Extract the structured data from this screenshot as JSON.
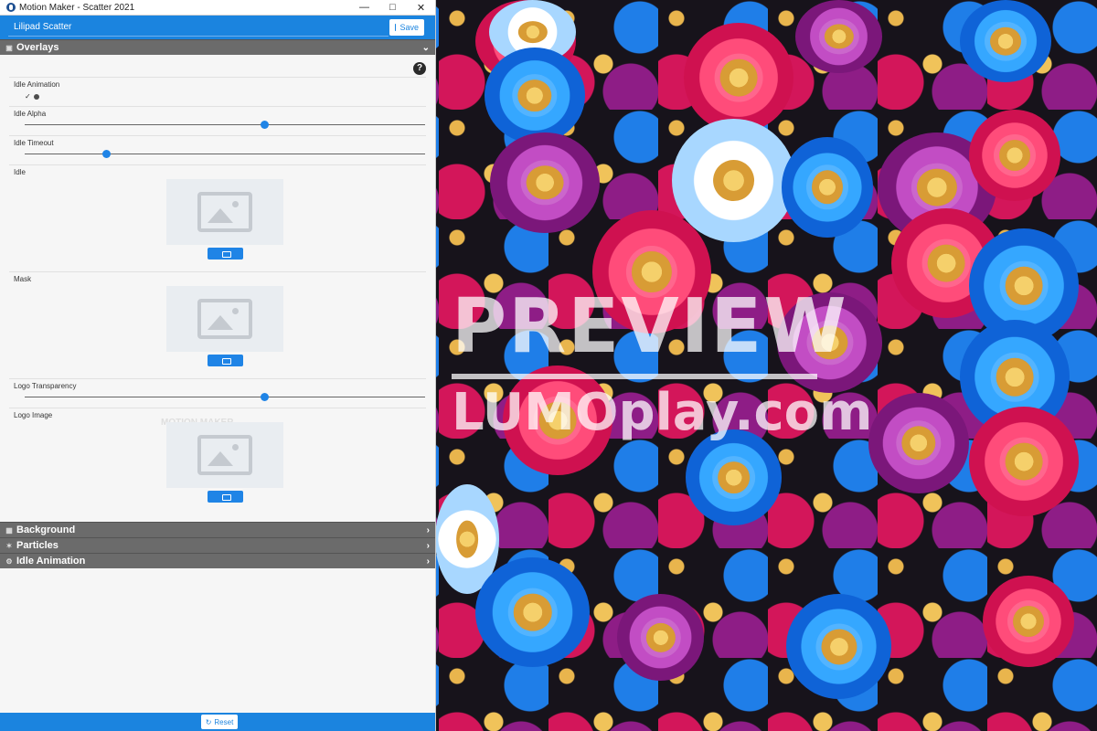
{
  "window": {
    "title": "Motion Maker - Scatter 2021",
    "controls": {
      "minimize": "—",
      "maximize": "□",
      "close": "✕"
    }
  },
  "toolbar": {
    "input_value": "Lilipad Scatter",
    "save_label": "Save"
  },
  "overlays": {
    "title": "Overlays",
    "help": "?",
    "fields": {
      "idle_animation": "Idle Animation",
      "idle_alpha": "Idle Alpha",
      "idle_timeout": "Idle Timeout",
      "idle": "Idle",
      "mask": "Mask",
      "logo_transparency": "Logo Transparency",
      "logo_image": "Logo Image"
    },
    "checkbox_mark": "✓",
    "slider_values": {
      "idle_alpha": 0.6,
      "idle_timeout": 0.2,
      "logo_transparency": 0.6
    },
    "logo_watermark": "MOTION MAKER"
  },
  "sections": [
    {
      "name": "Background",
      "icon": "image-icon"
    },
    {
      "name": "Particles",
      "icon": "sparkles-icon"
    },
    {
      "name": "Idle Animation",
      "icon": "gear-icon"
    }
  ],
  "footer": {
    "reset_label": "Reset"
  },
  "preview": {
    "watermark_line1": "PREVIEW",
    "watermark_line2": "LUMOplay.com"
  },
  "colors": {
    "accent": "#1b84df",
    "panel_header": "#6b6b6b"
  }
}
